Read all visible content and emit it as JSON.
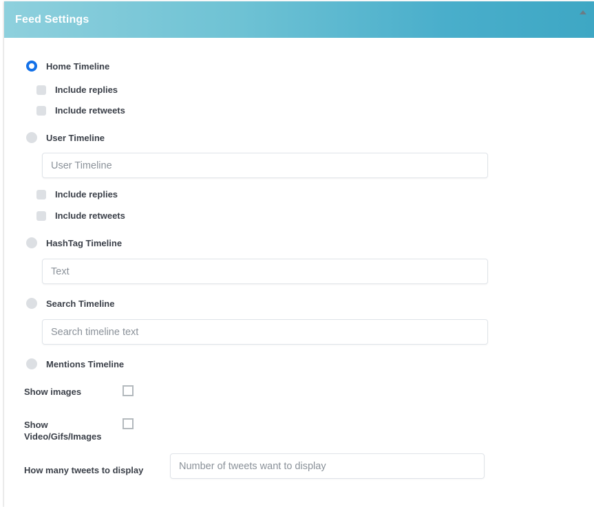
{
  "header": {
    "title": "Feed Settings",
    "collapse_icon": "caret-up-icon"
  },
  "timeline_options": [
    {
      "key": "home",
      "label": "Home Timeline",
      "selected": true,
      "sub_checkboxes": [
        {
          "key": "home_replies",
          "label": "Include replies",
          "checked": false
        },
        {
          "key": "home_retweets",
          "label": "Include retweets",
          "checked": false
        }
      ]
    },
    {
      "key": "user",
      "label": "User Timeline",
      "selected": false,
      "input": {
        "value": "",
        "placeholder": "User Timeline"
      },
      "sub_checkboxes": [
        {
          "key": "user_replies",
          "label": "Include replies",
          "checked": false
        },
        {
          "key": "user_retweets",
          "label": "Include retweets",
          "checked": false
        }
      ]
    },
    {
      "key": "hashtag",
      "label": "HashTag Timeline",
      "selected": false,
      "input": {
        "value": "",
        "placeholder": "Text"
      }
    },
    {
      "key": "search",
      "label": "Search Timeline",
      "selected": false,
      "input": {
        "value": "",
        "placeholder": "Search timeline text"
      }
    },
    {
      "key": "mentions",
      "label": "Mentions Timeline",
      "selected": false
    }
  ],
  "toggles": [
    {
      "key": "show_images",
      "label": "Show images",
      "checked": false
    },
    {
      "key": "show_media",
      "label_line1": "Show",
      "label_line2": "Video/Gifs/Images",
      "checked": false
    }
  ],
  "tweet_count": {
    "label": "How many tweets to display",
    "value": "",
    "placeholder": "Number of tweets want to display"
  },
  "colors": {
    "header_gradient_start": "#8ed0dd",
    "header_gradient_end": "#3ea7c4",
    "radio_selected": "#1471e8",
    "control_grey": "#dde0e4",
    "label_text": "#3a3f48",
    "placeholder_text": "#8a9199"
  }
}
